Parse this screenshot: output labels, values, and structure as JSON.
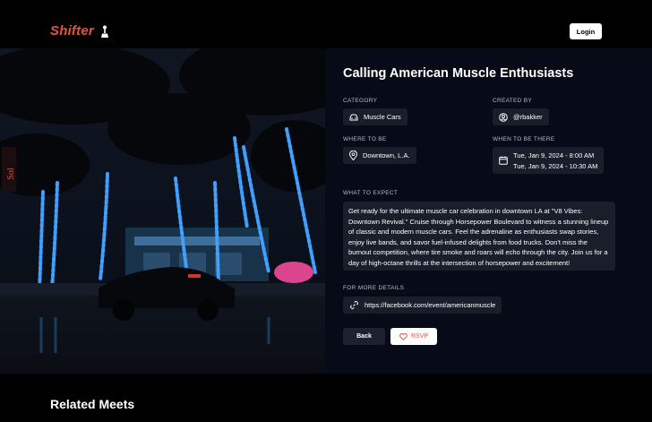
{
  "header": {
    "logo_text": "Shifter",
    "logo_icon": "gear-shifter-icon",
    "login_label": "Login"
  },
  "hero": {
    "image_icon": "night-street-palm-trees-image",
    "sign_text": "Sol"
  },
  "event": {
    "title": "Calling American Muscle Enthusiasts",
    "category_label": "CATEGORY",
    "category_value": "Muscle Cars",
    "created_by_label": "CREATED BY",
    "created_by_value": "@rbakker",
    "where_label": "WHERE TO BE",
    "where_value": "Downtown, L.A.",
    "when_label": "WHEN TO BE THERE",
    "when_start": "Tue, Jan 9, 2024 - 8:00 AM",
    "when_end": "Tue, Jan 9, 2024 - 10:30 AM",
    "expect_label": "WHAT TO EXPECT",
    "expect_text": "Get ready for the ultimate muscle car celebration in downtown LA at \"V8 Vibes: Downtown Revival.\" Cruise through Horsepower Boulevard to witness a stunning lineup of classic and modern muscle cars. Feel the adrenaline as enthusiasts swap stories, enjoy live bands, and savor fuel-infused delights from food trucks. Don't miss the burnout competition, where tire smoke and roars will echo through the city. Join us for a day of high-octane thrills at the intersection of horsepower and excitement!",
    "details_label": "FOR MORE DETAILS",
    "details_link": "https://facebook.com/event/americanmuscle",
    "back_label": "Back",
    "rsvp_label": "RSVP"
  },
  "related": {
    "heading": "Related Meets"
  },
  "colors": {
    "accent": "#e25545",
    "panel_bg": "#070b18",
    "chip_bg": "#1a1e2b",
    "neon_blue": "#3fa0ff",
    "neon_pink": "#ff4fa3"
  }
}
